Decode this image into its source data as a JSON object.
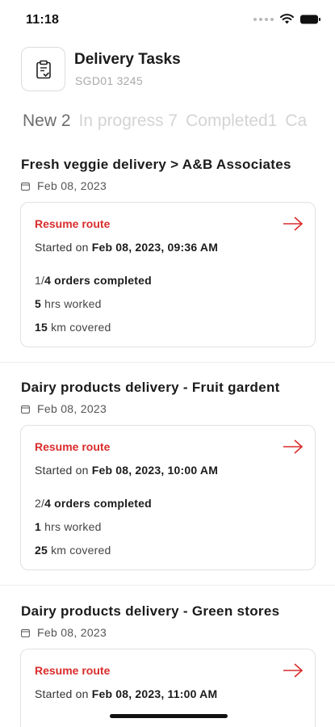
{
  "status_bar": {
    "time": "11:18"
  },
  "header": {
    "title": "Delivery Tasks",
    "subtitle": "SGD01 3245"
  },
  "tabs": [
    {
      "label": "New 2",
      "active": true
    },
    {
      "label": "In progress 7",
      "active": false
    },
    {
      "label": "Completed1",
      "active": false
    },
    {
      "label": "Ca",
      "active": false
    }
  ],
  "tasks": [
    {
      "title": "Fresh veggie delivery > A&B Associates",
      "date": "Feb 08, 2023",
      "action_label": "Resume route",
      "started_prefix": "Started on",
      "started_value": "Feb 08, 2023, 09:36 AM",
      "orders_done": "1/",
      "orders_total": "4 orders completed",
      "hours_value": "5",
      "hours_label": "hrs worked",
      "km_value": "15",
      "km_label": "km covered"
    },
    {
      "title": "Dairy products delivery - Fruit gardent",
      "date": "Feb 08, 2023",
      "action_label": "Resume route",
      "started_prefix": "Started on",
      "started_value": "Feb 08, 2023, 10:00 AM",
      "orders_done": "2/",
      "orders_total": "4 orders completed",
      "hours_value": "1",
      "hours_label": "hrs worked",
      "km_value": "25",
      "km_label": "km covered"
    },
    {
      "title": "Dairy products delivery - Green stores",
      "date": "Feb 08, 2023",
      "action_label": "Resume route",
      "started_prefix": "Started on",
      "started_value": "Feb 08, 2023, 11:00 AM"
    }
  ],
  "colors": {
    "accent": "#d92c2c",
    "tab_active": "#6d6d6d",
    "tab_inactive": "#d4d4d4"
  },
  "icons": {
    "header": "clipboard-check-icon",
    "date": "calendar-icon",
    "action": "arrow-right-icon"
  }
}
